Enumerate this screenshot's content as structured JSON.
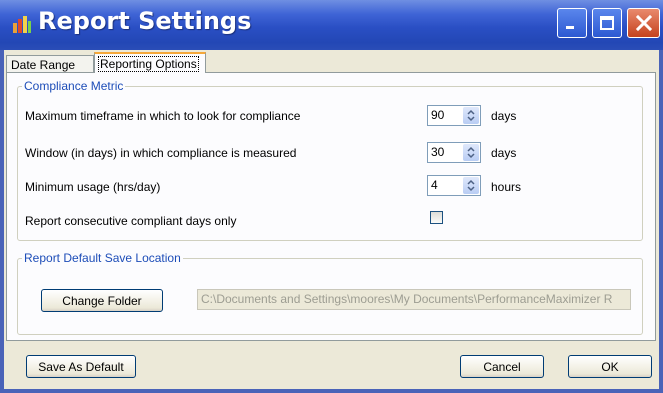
{
  "window": {
    "title": "Report Settings"
  },
  "tabs": [
    {
      "label": "Date Range"
    },
    {
      "label": "Reporting Options"
    }
  ],
  "compliance_group": {
    "legend": "Compliance Metric",
    "rows": [
      {
        "label": "Maximum timeframe in which to look for compliance",
        "value": "90",
        "unit": "days"
      },
      {
        "label": "Window (in days) in which compliance is measured",
        "value": "30",
        "unit": "days"
      },
      {
        "label": "Minimum usage (hrs/day)",
        "value": "4",
        "unit": "hours"
      }
    ],
    "checkbox_label": "Report consecutive compliant days only",
    "checkbox_checked": false
  },
  "save_group": {
    "legend": "Report Default Save Location",
    "change_folder_label": "Change Folder",
    "path_value": "C:\\Documents and Settings\\moores\\My Documents\\PerformanceMaximizer R"
  },
  "footer": {
    "save_default_label": "Save As Default",
    "cancel_label": "Cancel",
    "ok_label": "OK"
  },
  "colors": {
    "titlebar": "#2a4fc4",
    "client": "#ece9d8",
    "group_legend": "#1d4db8",
    "close_button": "#c5421e"
  },
  "icons": [
    "app-icon",
    "minimize-icon",
    "maximize-icon",
    "close-icon",
    "spinner-arrows-icon"
  ]
}
